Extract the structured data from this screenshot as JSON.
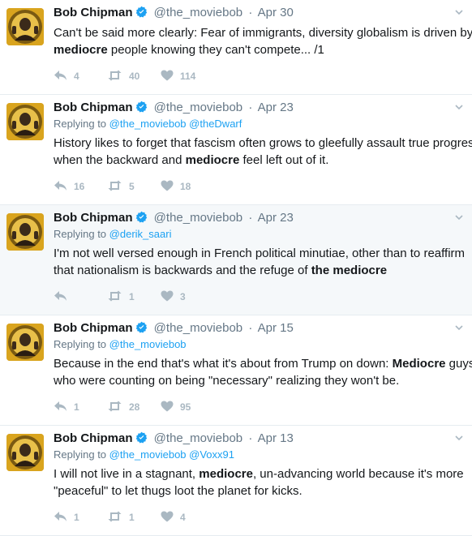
{
  "user": {
    "name": "Bob Chipman",
    "handle": "@the_moviebob"
  },
  "separator": "·",
  "icons": {
    "reply": "reply-icon",
    "retweet": "retweet-icon",
    "like": "heart-icon",
    "verified": "verified-badge-icon",
    "caret": "chevron-down-icon"
  },
  "colors": {
    "link": "#1da1f2",
    "muted": "#657786",
    "action": "#aab8c2",
    "highlight_bg": "#f5f8fa",
    "verified": "#1da1f2"
  },
  "tweets": [
    {
      "date": "Apr 30",
      "reply_label": "",
      "reply_to": "",
      "text": [
        {
          "pre": "Can't be said more clearly: Fear of immigrants, diversity globalism is driven by",
          "bold": "",
          "post": ""
        },
        {
          "pre": "",
          "bold": "mediocre",
          "post": " people knowing they can't compete... /1"
        }
      ],
      "replies": "4",
      "retweets": "40",
      "likes": "114"
    },
    {
      "date": "Apr 23",
      "reply_label": "Replying to",
      "reply_to": "@the_moviebob @theDwarf",
      "text": [
        {
          "pre": "History likes to forget that fascism often grows to gleefully assault true progress",
          "bold": "",
          "post": ""
        },
        {
          "pre": "when the backward and ",
          "bold": "mediocre",
          "post": " feel left out of it."
        }
      ],
      "replies": "16",
      "retweets": "5",
      "likes": "18"
    },
    {
      "date": "Apr 23",
      "reply_label": "Replying to",
      "reply_to": "@derik_saari",
      "text": [
        {
          "pre": "I'm not well versed enough in French political minutiae, other than to reaffirm",
          "bold": "",
          "post": ""
        },
        {
          "pre": "that nationalism is backwards and the refuge of ",
          "bold": "the mediocre",
          "post": ""
        }
      ],
      "replies": "",
      "retweets": "1",
      "likes": "3"
    },
    {
      "date": "Apr 15",
      "reply_label": "Replying to",
      "reply_to": "@the_moviebob",
      "text": [
        {
          "pre": "Because in the end that's what it's about from Trump on down: ",
          "bold": "Mediocre",
          "post": " guys"
        },
        {
          "pre": "who were counting on being \"necessary\" realizing they won't be.",
          "bold": "",
          "post": ""
        }
      ],
      "replies": "1",
      "retweets": "28",
      "likes": "95"
    },
    {
      "date": "Apr 13",
      "reply_label": "Replying to",
      "reply_to": "@the_moviebob @Voxx91",
      "text": [
        {
          "pre": "I will not live in a stagnant, ",
          "bold": "mediocre",
          "post": ", un-advancing world because it's more"
        },
        {
          "pre": "\"peaceful\" to let thugs loot the planet for kicks.",
          "bold": "",
          "post": ""
        }
      ],
      "replies": "1",
      "retweets": "1",
      "likes": "4"
    }
  ]
}
